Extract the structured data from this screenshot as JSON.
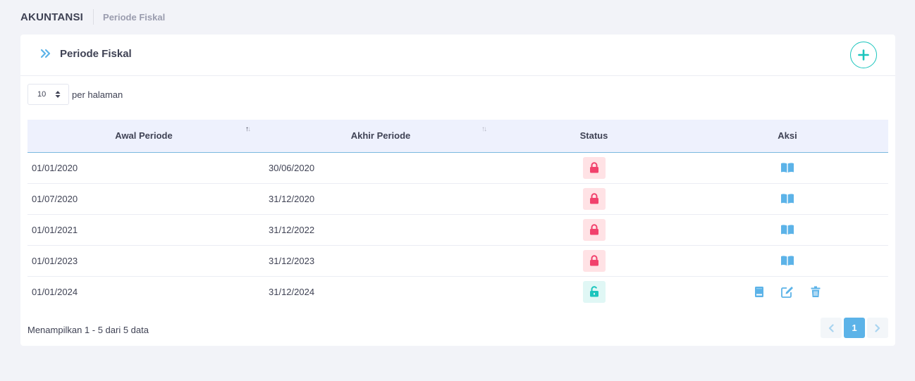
{
  "header": {
    "title": "AKUNTANSI",
    "breadcrumb": "Periode Fiskal"
  },
  "card": {
    "title": "Periode Fiskal",
    "icon": "double-chevron-right-icon",
    "add_icon": "plus-icon"
  },
  "per_page": {
    "value": "10",
    "label": "per halaman"
  },
  "table": {
    "columns": [
      "Awal Periode",
      "Akhir Periode",
      "Status",
      "Aksi"
    ],
    "rows": [
      {
        "start": "01/01/2020",
        "end": "30/06/2020",
        "status": "locked"
      },
      {
        "start": "01/07/2020",
        "end": "31/12/2020",
        "status": "locked"
      },
      {
        "start": "01/01/2021",
        "end": "31/12/2022",
        "status": "locked"
      },
      {
        "start": "01/01/2023",
        "end": "31/12/2023",
        "status": "locked"
      },
      {
        "start": "01/01/2024",
        "end": "31/12/2024",
        "status": "unlocked"
      }
    ]
  },
  "footer": {
    "info": "Menampilkan 1 - 5 dari 5 data",
    "current_page": "1"
  },
  "colors": {
    "accent": "#5cb3e8",
    "success": "#1bc5bd",
    "danger": "#f64e60",
    "header_bg": "#eef1fd"
  }
}
